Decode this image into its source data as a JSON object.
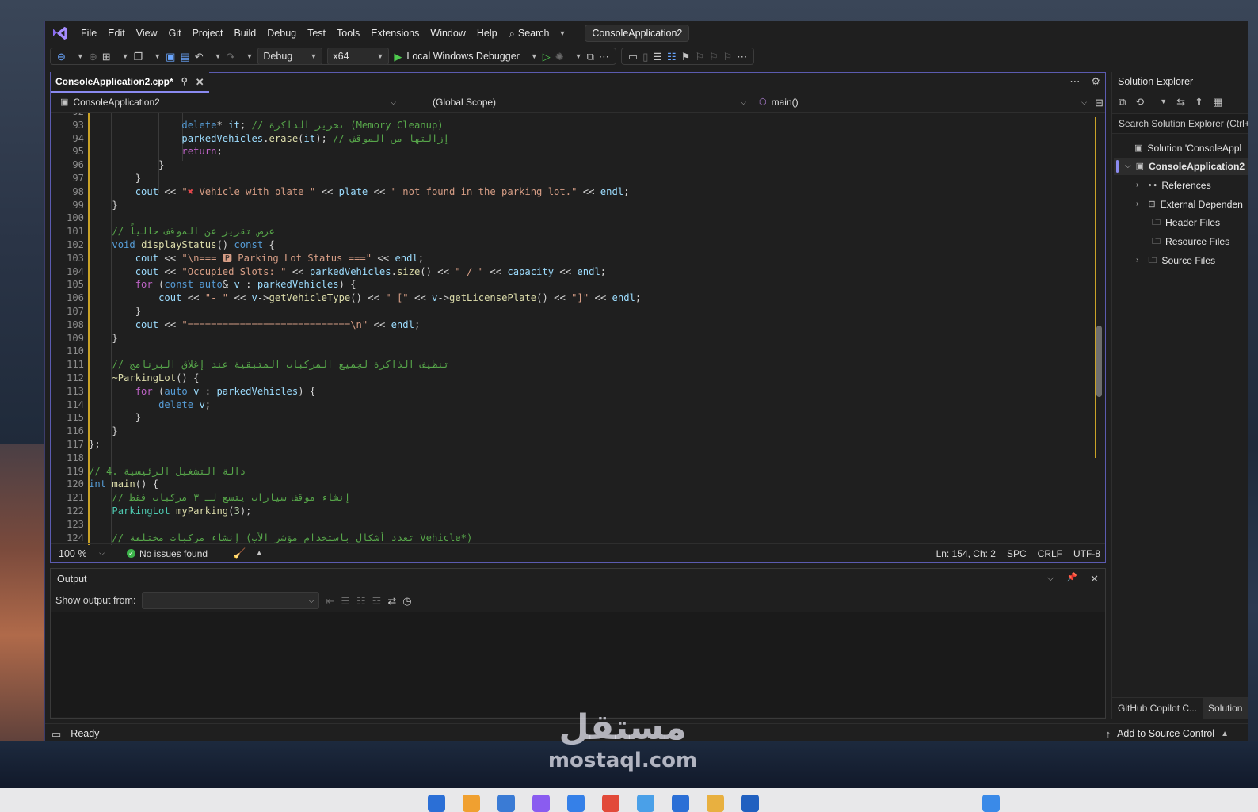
{
  "menubar": {
    "items": [
      "File",
      "Edit",
      "View",
      "Git",
      "Project",
      "Build",
      "Debug",
      "Test",
      "Tools",
      "Extensions",
      "Window",
      "Help"
    ],
    "search_label": "Search",
    "solution_name": "ConsoleApplication2"
  },
  "toolbar": {
    "config": "Debug",
    "platform": "x64",
    "debugger": "Local Windows Debugger"
  },
  "editor": {
    "tab_label": "ConsoleApplication2.cpp*",
    "nav_project": "ConsoleApplication2",
    "nav_scope": "(Global Scope)",
    "nav_member": "main()",
    "zoom": "100 %",
    "issues": "No issues found",
    "cursor_pos": "Ln: 154, Ch: 2",
    "whitespace": "SPC",
    "line_ending": "CRLF",
    "encoding": "UTF-8",
    "lines": [
      {
        "n": "92",
        "html": ""
      },
      {
        "n": "93",
        "html": "                <span class='k'>delete</span><span class='p'>* </span><span class='v'>it</span><span class='p'>; </span><span class='c'>// تحرير الذاكرة (Memory Cleanup)</span>"
      },
      {
        "n": "94",
        "html": "                <span class='v'>parkedVehicles</span><span class='p'>.</span><span class='f'>erase</span><span class='p'>(</span><span class='v'>it</span><span class='p'>); </span><span class='c'>// إزالتها من الموقف</span>"
      },
      {
        "n": "95",
        "html": "                <span class='m'>return</span><span class='p'>;</span>"
      },
      {
        "n": "96",
        "html": "            <span class='p'>}</span>"
      },
      {
        "n": "97",
        "html": "        <span class='p'>}</span>"
      },
      {
        "n": "98",
        "html": "        <span class='v'>cout</span><span class='p'> &lt;&lt; </span><span class='s'>\"<span style='color:#e5484d'>✖</span> Vehicle with plate \"</span><span class='p'> &lt;&lt; </span><span class='v'>plate</span><span class='p'> &lt;&lt; </span><span class='s'>\" not found in the parking lot.\"</span><span class='p'> &lt;&lt; </span><span class='v'>endl</span><span class='p'>;</span>"
      },
      {
        "n": "99",
        "html": "    <span class='p'>}</span>"
      },
      {
        "n": "100",
        "html": ""
      },
      {
        "n": "101",
        "html": "    <span class='c'>// عرض تقرير عن الموقف حالياً</span>"
      },
      {
        "n": "102",
        "html": "    <span class='k'>void</span><span class='p'> </span><span class='f'>displayStatus</span><span class='p'>() </span><span class='k'>const</span><span class='p'> {</span>"
      },
      {
        "n": "103",
        "html": "        <span class='v'>cout</span><span class='p'> &lt;&lt; </span><span class='s'>\"\\n=== 🅿 Parking Lot Status ===\"</span><span class='p'> &lt;&lt; </span><span class='v'>endl</span><span class='p'>;</span>"
      },
      {
        "n": "104",
        "html": "        <span class='v'>cout</span><span class='p'> &lt;&lt; </span><span class='s'>\"Occupied Slots: \"</span><span class='p'> &lt;&lt; </span><span class='v'>parkedVehicles</span><span class='p'>.</span><span class='f'>size</span><span class='p'>() &lt;&lt; </span><span class='s'>\" / \"</span><span class='p'> &lt;&lt; </span><span class='v'>capacity</span><span class='p'> &lt;&lt; </span><span class='v'>endl</span><span class='p'>;</span>"
      },
      {
        "n": "105",
        "html": "        <span class='m'>for</span><span class='p'> (</span><span class='k'>const auto</span><span class='p'>&amp; </span><span class='v'>v</span><span class='p'> : </span><span class='v'>parkedVehicles</span><span class='p'>) {</span>"
      },
      {
        "n": "106",
        "html": "            <span class='v'>cout</span><span class='p'> &lt;&lt; </span><span class='s'>\"- \"</span><span class='p'> &lt;&lt; </span><span class='v'>v</span><span class='p'>-&gt;</span><span class='f'>getVehicleType</span><span class='p'>() &lt;&lt; </span><span class='s'>\" [\"</span><span class='p'> &lt;&lt; </span><span class='v'>v</span><span class='p'>-&gt;</span><span class='f'>getLicensePlate</span><span class='p'>() &lt;&lt; </span><span class='s'>\"]\"</span><span class='p'> &lt;&lt; </span><span class='v'>endl</span><span class='p'>;</span>"
      },
      {
        "n": "107",
        "html": "        <span class='p'>}</span>"
      },
      {
        "n": "108",
        "html": "        <span class='v'>cout</span><span class='p'> &lt;&lt; </span><span class='s'>\"============================\\n\"</span><span class='p'> &lt;&lt; </span><span class='v'>endl</span><span class='p'>;</span>"
      },
      {
        "n": "109",
        "html": "    <span class='p'>}</span>"
      },
      {
        "n": "110",
        "html": ""
      },
      {
        "n": "111",
        "html": "    <span class='c'>// تنظيف الذاكرة لجميع المركبات المتبقية عند إغلاق البرنامج</span>"
      },
      {
        "n": "112",
        "html": "    <span class='f'>~ParkingLot</span><span class='p'>() {</span>"
      },
      {
        "n": "113",
        "html": "        <span class='m'>for</span><span class='p'> (</span><span class='k'>auto</span><span class='p'> </span><span class='v'>v</span><span class='p'> : </span><span class='v'>parkedVehicles</span><span class='p'>) {</span>"
      },
      {
        "n": "114",
        "html": "            <span class='k'>delete</span><span class='p'> </span><span class='v'>v</span><span class='p'>;</span>"
      },
      {
        "n": "115",
        "html": "        <span class='p'>}</span>"
      },
      {
        "n": "116",
        "html": "    <span class='p'>}</span>"
      },
      {
        "n": "117",
        "html": "<span class='p'>};</span>"
      },
      {
        "n": "118",
        "html": ""
      },
      {
        "n": "119",
        "html": "<span class='c'>// 4. دالة التشغيل الرئيسية</span>"
      },
      {
        "n": "120",
        "html": "<span class='k'>int</span><span class='p'> </span><span class='f'>main</span><span class='p'>() {</span>"
      },
      {
        "n": "121",
        "html": "    <span class='c'>// إنشاء موقف سيارات يتسع لـ ٣ مركبات فقط</span>"
      },
      {
        "n": "122",
        "html": "    <span class='t'>ParkingLot</span><span class='p'> </span><span class='f'>myParking</span><span class='p'>(</span><span class='n'>3</span><span class='p'>);</span>"
      },
      {
        "n": "123",
        "html": ""
      },
      {
        "n": "124",
        "html": "    <span class='c'>// إنشاء مركبات مختلفة (تعدد أشكال باستخدام مؤشر الأب Vehicle*)</span>"
      }
    ]
  },
  "output": {
    "title": "Output",
    "show_from_label": "Show output from:",
    "show_from_value": ""
  },
  "solution_explorer": {
    "title": "Solution Explorer",
    "search_placeholder": "Search Solution Explorer (Ctrl+",
    "items": [
      {
        "label": "Solution 'ConsoleAppl"
      },
      {
        "label": "ConsoleApplication2"
      },
      {
        "label": "References"
      },
      {
        "label": "External Dependen"
      },
      {
        "label": "Header Files"
      },
      {
        "label": "Resource Files"
      },
      {
        "label": "Source Files"
      }
    ],
    "bottom_tabs": [
      "GitHub Copilot C...",
      "Solution"
    ]
  },
  "status": {
    "ready": "Ready",
    "source_control": "Add to Source Control"
  },
  "watermark": {
    "arabic": "مستقل",
    "latin": "mostaql.com"
  }
}
